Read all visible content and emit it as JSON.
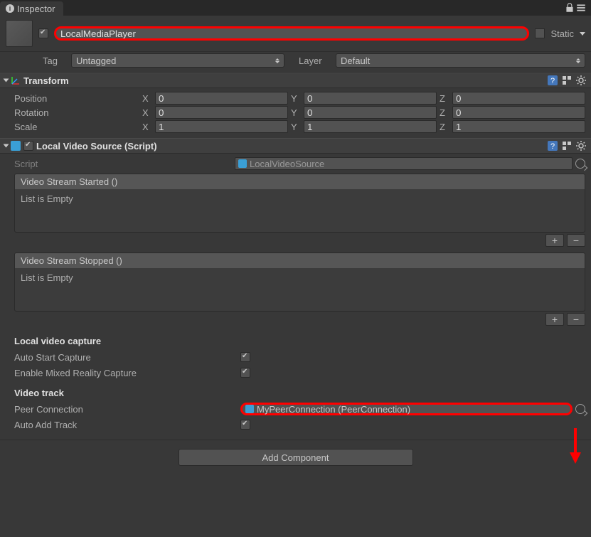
{
  "tab": {
    "title": "Inspector"
  },
  "gameObject": {
    "enabled": true,
    "name": "LocalMediaPlayer",
    "static_label": "Static",
    "tag_label": "Tag",
    "tag_value": "Untagged",
    "layer_label": "Layer",
    "layer_value": "Default"
  },
  "transform": {
    "title": "Transform",
    "position": {
      "label": "Position",
      "x": "0",
      "y": "0",
      "z": "0"
    },
    "rotation": {
      "label": "Rotation",
      "x": "0",
      "y": "0",
      "z": "0"
    },
    "scale": {
      "label": "Scale",
      "x": "1",
      "y": "1",
      "z": "1"
    }
  },
  "localVideoSource": {
    "title": "Local Video Source (Script)",
    "script_label": "Script",
    "script_value": "LocalVideoSource",
    "event_started": {
      "title": "Video Stream Started ()",
      "empty": "List is Empty"
    },
    "event_stopped": {
      "title": "Video Stream Stopped ()",
      "empty": "List is Empty"
    },
    "local_capture_header": "Local video capture",
    "auto_start_label": "Auto Start Capture",
    "mixed_reality_label": "Enable Mixed Reality Capture",
    "video_track_header": "Video track",
    "peer_connection_label": "Peer Connection",
    "peer_connection_value": "MyPeerConnection (PeerConnection)",
    "auto_add_track_label": "Auto Add Track"
  },
  "addComponent": "Add Component",
  "axis": {
    "x": "X",
    "y": "Y",
    "z": "Z"
  }
}
